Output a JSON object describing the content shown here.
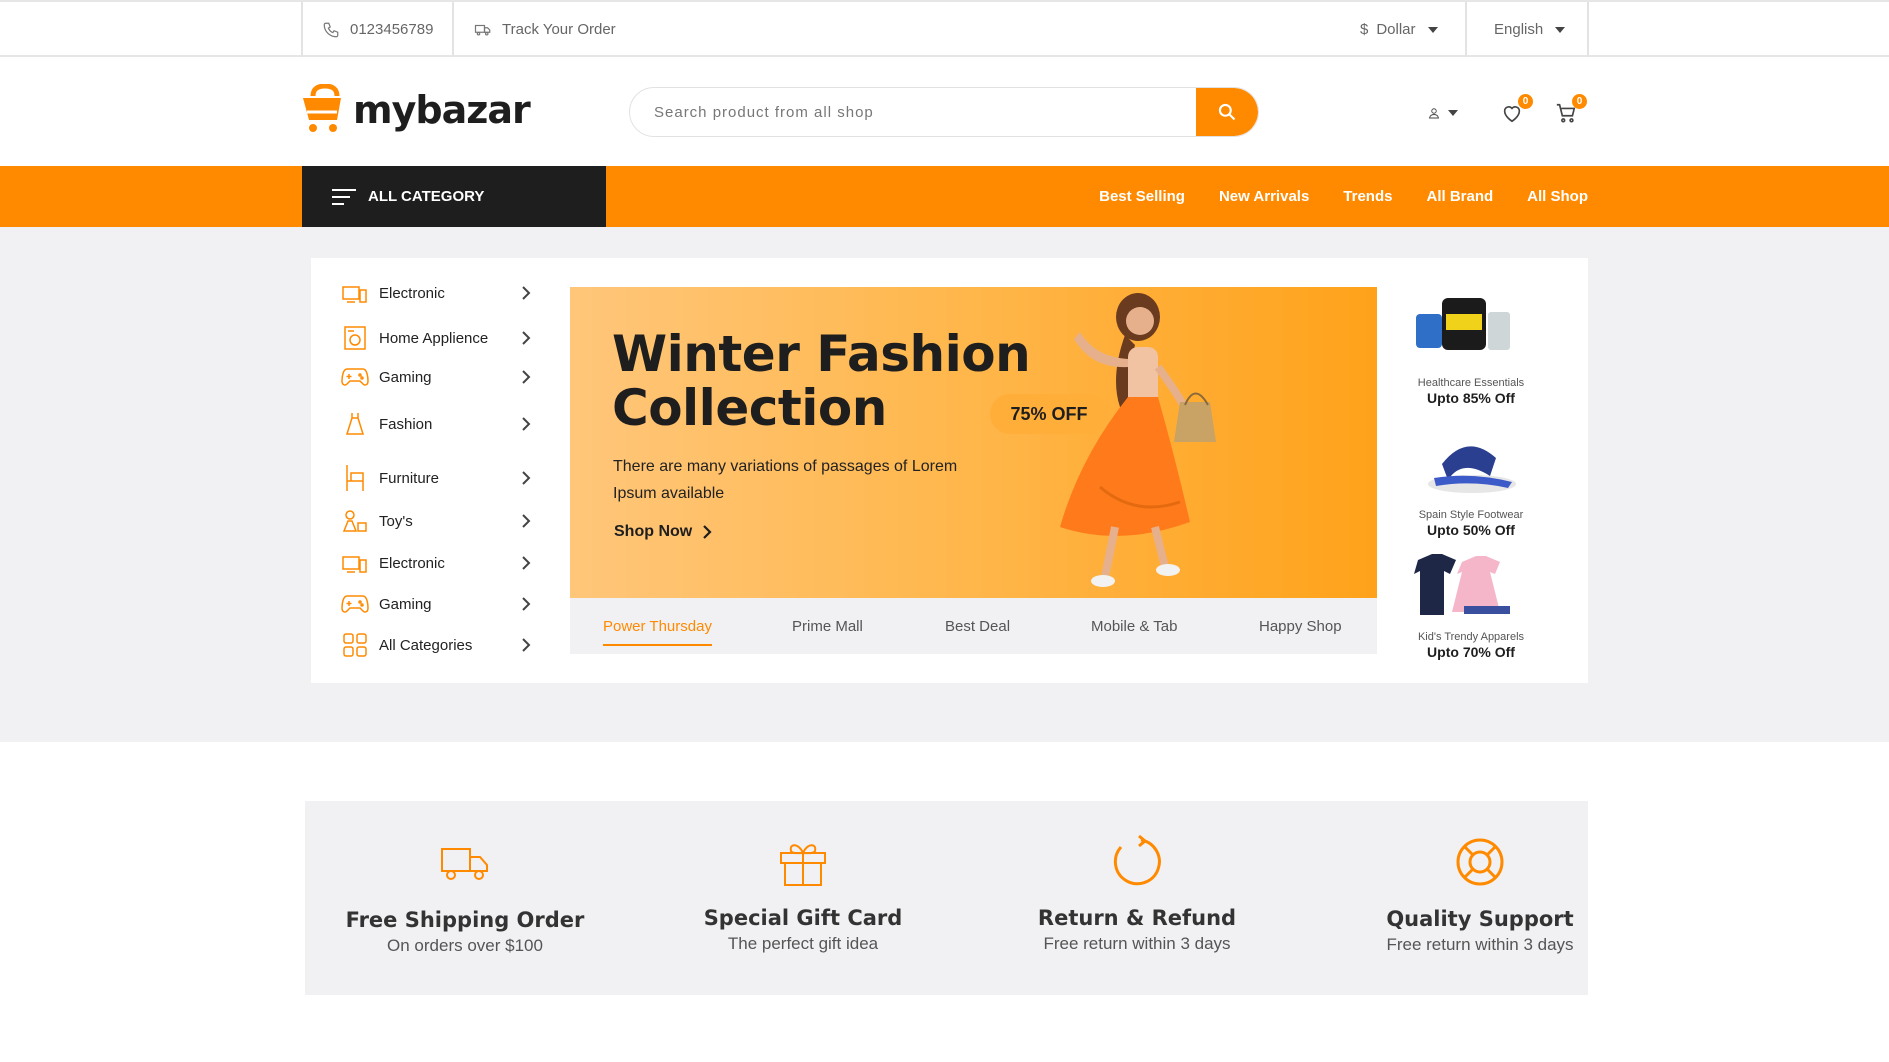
{
  "topbar": {
    "phone": "0123456789",
    "track": "Track Your Order",
    "currency_symbol": "$",
    "currency": "Dollar",
    "language": "English"
  },
  "header": {
    "logo_text": "mybazar",
    "search_placeholder": "Search product from all shop",
    "wishlist_count": "0",
    "cart_count": "0"
  },
  "nav": {
    "all_category": "ALL CATEGORY",
    "links": [
      "Best Selling",
      "New Arrivals",
      "Trends",
      "All Brand",
      "All Shop"
    ]
  },
  "categories": [
    {
      "label": "Electronic",
      "icon": "tv-icon"
    },
    {
      "label": "Home Applience",
      "icon": "washing-machine-icon"
    },
    {
      "label": "Gaming",
      "icon": "gamepad-icon"
    },
    {
      "label": "Fashion",
      "icon": "dress-icon"
    },
    {
      "label": "Furniture",
      "icon": "chair-icon"
    },
    {
      "label": "Toy's",
      "icon": "toy-icon"
    },
    {
      "label": "Electronic",
      "icon": "tv-icon"
    },
    {
      "label": "Gaming",
      "icon": "gamepad-icon"
    },
    {
      "label": "All Categories",
      "icon": "grid-icon"
    }
  ],
  "banner": {
    "title_line1": "Winter Fashion",
    "title_line2": "Collection",
    "discount": "75% OFF",
    "text": "There are many variations of passages of Lorem Ipsum available",
    "cta": "Shop Now"
  },
  "tabs": [
    "Power Thursday",
    "Prime Mall",
    "Best Deal",
    "Mobile & Tab",
    "Happy Shop"
  ],
  "promos": [
    {
      "title": "Healthcare Essentials",
      "off": "Upto 85% Off"
    },
    {
      "title": "Spain Style Footwear",
      "off": "Upto 50% Off"
    },
    {
      "title": "Kid's Trendy Apparels",
      "off": "Upto 70% Off"
    }
  ],
  "features": [
    {
      "title": "Free Shipping Order",
      "sub": "On orders over $100",
      "icon": "truck-icon"
    },
    {
      "title": "Special Gift Card",
      "sub": "The perfect gift idea",
      "icon": "gift-icon"
    },
    {
      "title": "Return & Refund",
      "sub": "Free return within 3 days",
      "icon": "refresh-icon"
    },
    {
      "title": "Quality Support",
      "sub": "Free return within 3 days",
      "icon": "lifebuoy-icon"
    }
  ],
  "colors": {
    "accent": "#ff8a00",
    "dark": "#1e1e1e",
    "section_bg": "#f1f1f4"
  }
}
